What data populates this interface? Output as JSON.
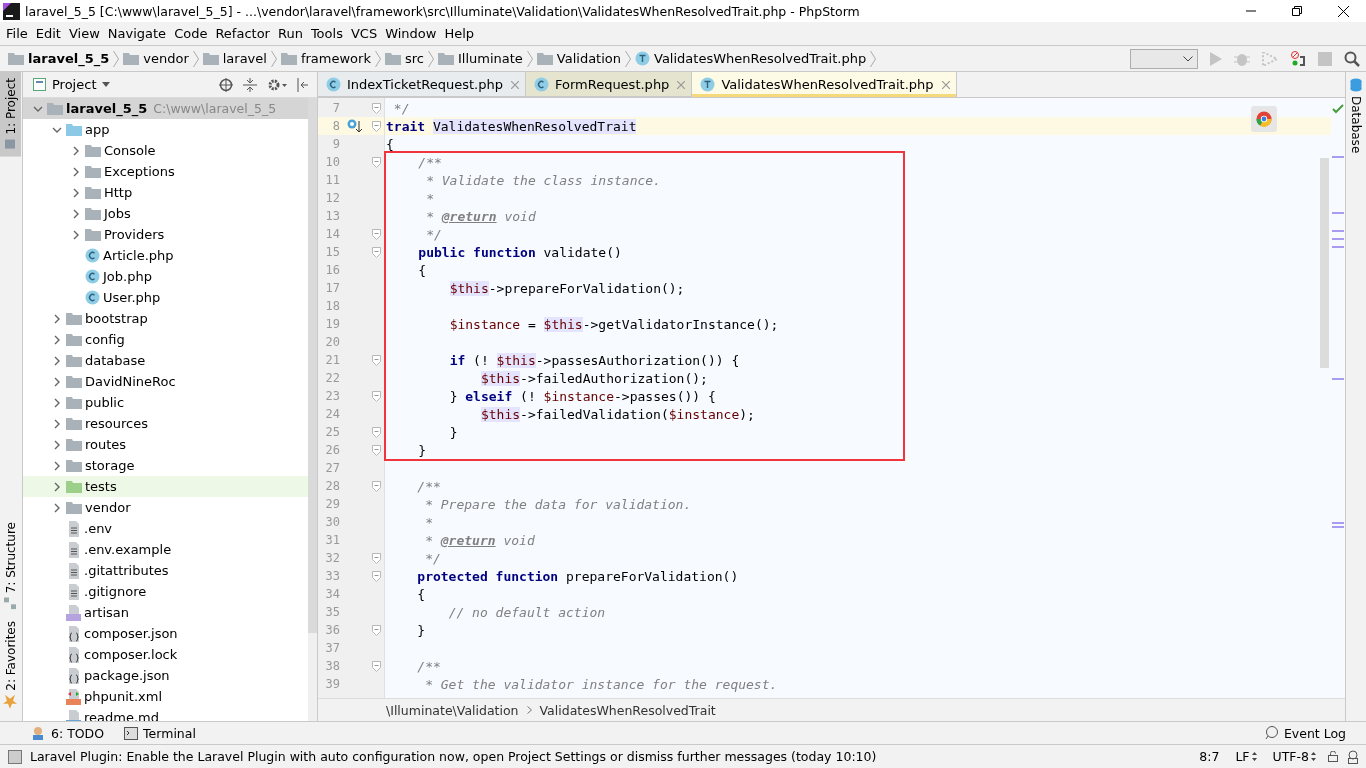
{
  "window": {
    "title": "laravel_5_5 [C:\\www\\laravel_5_5] - ...\\vendor\\laravel\\framework\\src\\Illuminate\\Validation\\ValidatesWhenResolvedTrait.php - PhpStorm"
  },
  "menu": [
    "File",
    "Edit",
    "View",
    "Navigate",
    "Code",
    "Refactor",
    "Run",
    "Tools",
    "VCS",
    "Window",
    "Help"
  ],
  "breadcrumb": [
    {
      "label": "laravel_5_5",
      "kind": "project"
    },
    {
      "label": "vendor",
      "kind": "folder"
    },
    {
      "label": "laravel",
      "kind": "folder"
    },
    {
      "label": "framework",
      "kind": "folder"
    },
    {
      "label": "src",
      "kind": "folder"
    },
    {
      "label": "Illuminate",
      "kind": "folder"
    },
    {
      "label": "Validation",
      "kind": "folder"
    },
    {
      "label": "ValidatesWhenResolvedTrait.php",
      "kind": "trait"
    }
  ],
  "left_stripe": [
    {
      "label": "1: Project",
      "selected": true
    },
    {
      "label": "7: Structure",
      "selected": false
    },
    {
      "label": "2: Favorites",
      "selected": false
    }
  ],
  "right_stripe": [
    {
      "label": "Database"
    }
  ],
  "project_panel": {
    "title": "Project",
    "tree": [
      {
        "label": "laravel_5_5",
        "path": "C:\\www\\laravel_5_5",
        "kind": "project",
        "expanded": true,
        "selected": true,
        "children": [
          {
            "label": "app",
            "kind": "source-folder",
            "expanded": true,
            "selected": false,
            "children": [
              {
                "label": "Console",
                "kind": "folder",
                "expanded": false,
                "selected": false
              },
              {
                "label": "Exceptions",
                "kind": "folder",
                "expanded": false,
                "selected": false
              },
              {
                "label": "Http",
                "kind": "folder",
                "expanded": false,
                "selected": false
              },
              {
                "label": "Jobs",
                "kind": "folder",
                "expanded": false,
                "selected": false
              },
              {
                "label": "Providers",
                "kind": "folder",
                "expanded": false,
                "selected": false
              },
              {
                "label": "Article.php",
                "kind": "class",
                "selected": false
              },
              {
                "label": "Job.php",
                "kind": "class",
                "selected": false
              },
              {
                "label": "User.php",
                "kind": "class",
                "selected": false
              }
            ]
          },
          {
            "label": "bootstrap",
            "kind": "folder",
            "expanded": false,
            "selected": false
          },
          {
            "label": "config",
            "kind": "folder",
            "expanded": false,
            "selected": false
          },
          {
            "label": "database",
            "kind": "folder",
            "expanded": false,
            "selected": false
          },
          {
            "label": "DavidNineRoc",
            "kind": "folder",
            "expanded": false,
            "selected": false
          },
          {
            "label": "public",
            "kind": "folder",
            "expanded": false,
            "selected": false
          },
          {
            "label": "resources",
            "kind": "folder",
            "expanded": false,
            "selected": false
          },
          {
            "label": "routes",
            "kind": "folder",
            "expanded": false,
            "selected": false
          },
          {
            "label": "storage",
            "kind": "folder",
            "expanded": false,
            "selected": false
          },
          {
            "label": "tests",
            "kind": "test-folder",
            "expanded": false,
            "selected": false
          },
          {
            "label": "vendor",
            "kind": "folder",
            "expanded": false,
            "selected": false
          },
          {
            "label": ".env",
            "kind": "text-file",
            "selected": false
          },
          {
            "label": ".env.example",
            "kind": "text-file",
            "selected": false
          },
          {
            "label": ".gitattributes",
            "kind": "text-file",
            "selected": false
          },
          {
            "label": ".gitignore",
            "kind": "text-file",
            "selected": false
          },
          {
            "label": "artisan",
            "kind": "php-file",
            "selected": false
          },
          {
            "label": "composer.json",
            "kind": "json-file",
            "selected": false
          },
          {
            "label": "composer.lock",
            "kind": "json-file",
            "selected": false
          },
          {
            "label": "package.json",
            "kind": "json-file",
            "selected": false
          },
          {
            "label": "phpunit.xml",
            "kind": "xml-file",
            "selected": false
          },
          {
            "label": "readme.md",
            "kind": "md-file",
            "selected": false
          }
        ]
      }
    ]
  },
  "tabs": [
    {
      "label": "IndexTicketRequest.php",
      "kind": "class",
      "selected": false,
      "color": "#e8ecef"
    },
    {
      "label": "FormRequest.php",
      "kind": "class",
      "selected": false,
      "color": "#e4e4cf"
    },
    {
      "label": "ValidatesWhenResolvedTrait.php",
      "kind": "trait",
      "selected": true,
      "color": "#fdfbe6"
    }
  ],
  "editor": {
    "blocks": [
      {
        "boxed": false,
        "lines": [
          {
            "n": "7",
            "fold": true,
            "current": false,
            "tokens": [
              {
                "kind": "comment",
                "text": " */"
              }
            ]
          },
          {
            "n": "8",
            "fold": true,
            "current": true,
            "tokens": [
              {
                "kind": "kw",
                "text": "trait"
              },
              {
                "kind": "ident",
                "text": " ValidatesWhenResolvedTrait"
              }
            ]
          },
          {
            "n": "9",
            "fold": false,
            "current": false,
            "tokens": [
              {
                "kind": "plain",
                "text": "{"
              }
            ]
          }
        ]
      },
      {
        "boxed": true,
        "lines": [
          {
            "n": "10",
            "fold": true,
            "current": false,
            "tokens": [
              {
                "kind": "comment",
                "text": "    /**"
              }
            ]
          },
          {
            "n": "11",
            "fold": false,
            "current": false,
            "tokens": [
              {
                "kind": "comment",
                "text": "     * Validate the class instance."
              }
            ]
          },
          {
            "n": "12",
            "fold": false,
            "current": false,
            "tokens": [
              {
                "kind": "comment",
                "text": "     *"
              }
            ]
          },
          {
            "n": "13",
            "fold": false,
            "current": false,
            "tokens": [
              {
                "kind": "comment",
                "text": "     * "
              },
              {
                "kind": "doctag",
                "text": "@return"
              },
              {
                "kind": "comment",
                "text": " void"
              }
            ]
          },
          {
            "n": "14",
            "fold": true,
            "current": false,
            "tokens": [
              {
                "kind": "comment",
                "text": "     */"
              }
            ]
          },
          {
            "n": "15",
            "fold": true,
            "current": false,
            "tokens": [
              {
                "kind": "kw",
                "text": "    public function"
              },
              {
                "kind": "plain",
                "text": " validate()"
              }
            ]
          },
          {
            "n": "16",
            "fold": false,
            "current": false,
            "tokens": [
              {
                "kind": "plain",
                "text": "    {"
              }
            ]
          },
          {
            "n": "17",
            "fold": false,
            "current": false,
            "tokens": [
              {
                "kind": "this",
                "text": "        $this"
              },
              {
                "kind": "plain",
                "text": "->prepareForValidation();"
              }
            ]
          },
          {
            "n": "18",
            "fold": false,
            "current": false
          },
          {
            "n": "19",
            "fold": false,
            "current": false,
            "tokens": [
              {
                "kind": "var",
                "text": "        $instance"
              },
              {
                "kind": "plain",
                "text": " = "
              },
              {
                "kind": "this",
                "text": "$this"
              },
              {
                "kind": "plain",
                "text": "->getValidatorInstance();"
              }
            ]
          },
          {
            "n": "20",
            "fold": false,
            "current": false
          },
          {
            "n": "21",
            "fold": true,
            "current": false,
            "tokens": [
              {
                "kind": "kw",
                "text": "        if"
              },
              {
                "kind": "plain",
                "text": " (! "
              },
              {
                "kind": "this",
                "text": "$this"
              },
              {
                "kind": "plain",
                "text": "->passesAuthorization()) {"
              }
            ]
          },
          {
            "n": "22",
            "fold": false,
            "current": false,
            "tokens": [
              {
                "kind": "this",
                "text": "            $this"
              },
              {
                "kind": "plain",
                "text": "->failedAuthorization();"
              }
            ]
          },
          {
            "n": "23",
            "fold": true,
            "current": false,
            "tokens": [
              {
                "kind": "plain",
                "text": "        } "
              },
              {
                "kind": "kw",
                "text": "elseif"
              },
              {
                "kind": "plain",
                "text": " (! "
              },
              {
                "kind": "var",
                "text": "$instance"
              },
              {
                "kind": "plain",
                "text": "->passes()) {"
              }
            ]
          },
          {
            "n": "24",
            "fold": false,
            "current": false,
            "tokens": [
              {
                "kind": "this",
                "text": "            $this"
              },
              {
                "kind": "plain",
                "text": "->failedValidation("
              },
              {
                "kind": "var",
                "text": "$instance"
              },
              {
                "kind": "plain",
                "text": ");"
              }
            ]
          },
          {
            "n": "25",
            "fold": true,
            "current": false,
            "tokens": [
              {
                "kind": "plain",
                "text": "        }"
              }
            ]
          },
          {
            "n": "26",
            "fold": true,
            "current": false,
            "tokens": [
              {
                "kind": "plain",
                "text": "    }"
              }
            ]
          }
        ]
      },
      {
        "boxed": false,
        "lines": [
          {
            "n": "27",
            "fold": false,
            "current": false
          },
          {
            "n": "28",
            "fold": true,
            "current": false,
            "tokens": [
              {
                "kind": "comment",
                "text": "    /**"
              }
            ]
          },
          {
            "n": "29",
            "fold": false,
            "current": false,
            "tokens": [
              {
                "kind": "comment",
                "text": "     * Prepare the data for validation."
              }
            ]
          },
          {
            "n": "30",
            "fold": false,
            "current": false,
            "tokens": [
              {
                "kind": "comment",
                "text": "     *"
              }
            ]
          },
          {
            "n": "31",
            "fold": false,
            "current": false,
            "tokens": [
              {
                "kind": "comment",
                "text": "     * "
              },
              {
                "kind": "doctag",
                "text": "@return"
              },
              {
                "kind": "comment",
                "text": " void"
              }
            ]
          },
          {
            "n": "32",
            "fold": true,
            "current": false,
            "tokens": [
              {
                "kind": "comment",
                "text": "     */"
              }
            ]
          },
          {
            "n": "33",
            "fold": true,
            "current": false,
            "tokens": [
              {
                "kind": "kw",
                "text": "    protected function"
              },
              {
                "kind": "plain",
                "text": " prepareForValidation()"
              }
            ]
          },
          {
            "n": "34",
            "fold": false,
            "current": false,
            "tokens": [
              {
                "kind": "plain",
                "text": "    {"
              }
            ]
          },
          {
            "n": "35",
            "fold": false,
            "current": false,
            "tokens": [
              {
                "kind": "comment",
                "text": "        // no default action"
              }
            ]
          },
          {
            "n": "36",
            "fold": true,
            "current": false,
            "tokens": [
              {
                "kind": "plain",
                "text": "    }"
              }
            ]
          },
          {
            "n": "37",
            "fold": false,
            "current": false
          },
          {
            "n": "38",
            "fold": true,
            "current": false,
            "tokens": [
              {
                "kind": "comment",
                "text": "    /**"
              }
            ]
          },
          {
            "n": "39",
            "fold": false,
            "current": false,
            "tokens": [
              {
                "kind": "comment",
                "text": "     * Get the validator instance for the request."
              }
            ]
          }
        ]
      }
    ],
    "path": [
      "\\Illuminate\\Validation",
      "ValidatesWhenResolvedTrait"
    ]
  },
  "tool_windows": {
    "left": [
      {
        "label": "6: TODO",
        "kind": "todo"
      },
      {
        "label": "Terminal",
        "kind": "terminal"
      }
    ],
    "right": [
      {
        "label": "Event Log",
        "kind": "log"
      }
    ]
  },
  "status_bar": {
    "message": "Laravel Plugin: Enable the Laravel Plugin with auto configuration now, open Project Settings or dismiss further messages (today 10:10)",
    "position": "8:7",
    "line_separator": "LF",
    "encoding": "UTF-8"
  }
}
